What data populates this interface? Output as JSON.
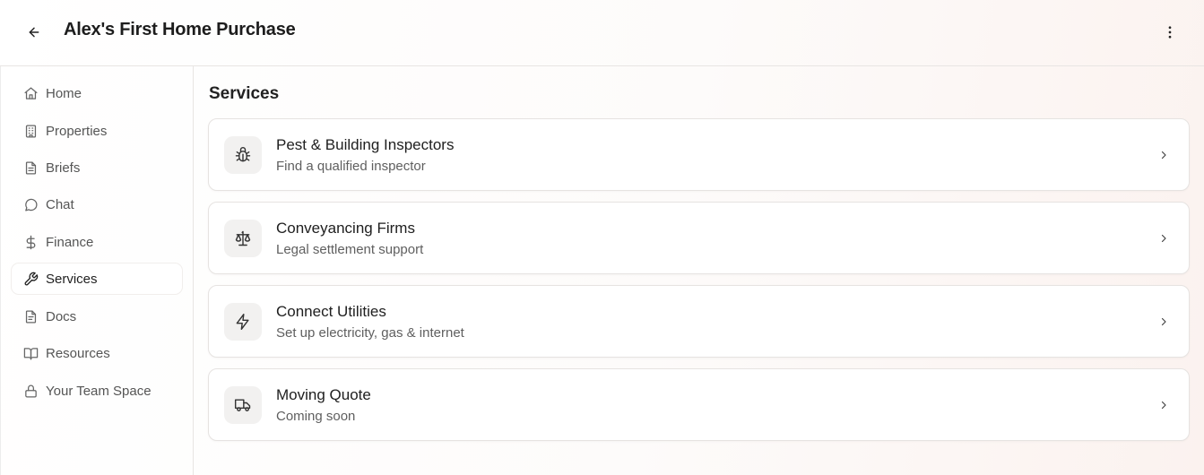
{
  "header": {
    "title": "Alex's First Home Purchase",
    "back_icon": "arrow-left-icon",
    "more_icon": "more-vertical-icon"
  },
  "sidebar": {
    "items": [
      {
        "label": "Home",
        "icon": "home-icon",
        "active": false
      },
      {
        "label": "Properties",
        "icon": "building-icon",
        "active": false
      },
      {
        "label": "Briefs",
        "icon": "file-text-icon",
        "active": false
      },
      {
        "label": "Chat",
        "icon": "chat-bubble-icon",
        "active": false
      },
      {
        "label": "Finance",
        "icon": "dollar-icon",
        "active": false
      },
      {
        "label": "Services",
        "icon": "wrench-icon",
        "active": true
      },
      {
        "label": "Docs",
        "icon": "document-icon",
        "active": false
      },
      {
        "label": "Resources",
        "icon": "book-icon",
        "active": false
      },
      {
        "label": "Your Team Space",
        "icon": "lock-icon",
        "active": false
      }
    ]
  },
  "main": {
    "title": "Services",
    "services": [
      {
        "title": "Pest & Building Inspectors",
        "subtitle": "Find a qualified inspector",
        "icon": "bug-icon"
      },
      {
        "title": "Conveyancing Firms",
        "subtitle": "Legal settlement support",
        "icon": "scale-icon"
      },
      {
        "title": "Connect Utilities",
        "subtitle": "Set up electricity, gas & internet",
        "icon": "lightning-icon"
      },
      {
        "title": "Moving Quote",
        "subtitle": "Coming soon",
        "icon": "truck-icon"
      }
    ]
  },
  "colors": {
    "text_primary": "#1f1f1f",
    "text_secondary": "#5f5f5f",
    "border": "#e6e3e1",
    "icon_tile_bg": "#f2f1f0"
  }
}
